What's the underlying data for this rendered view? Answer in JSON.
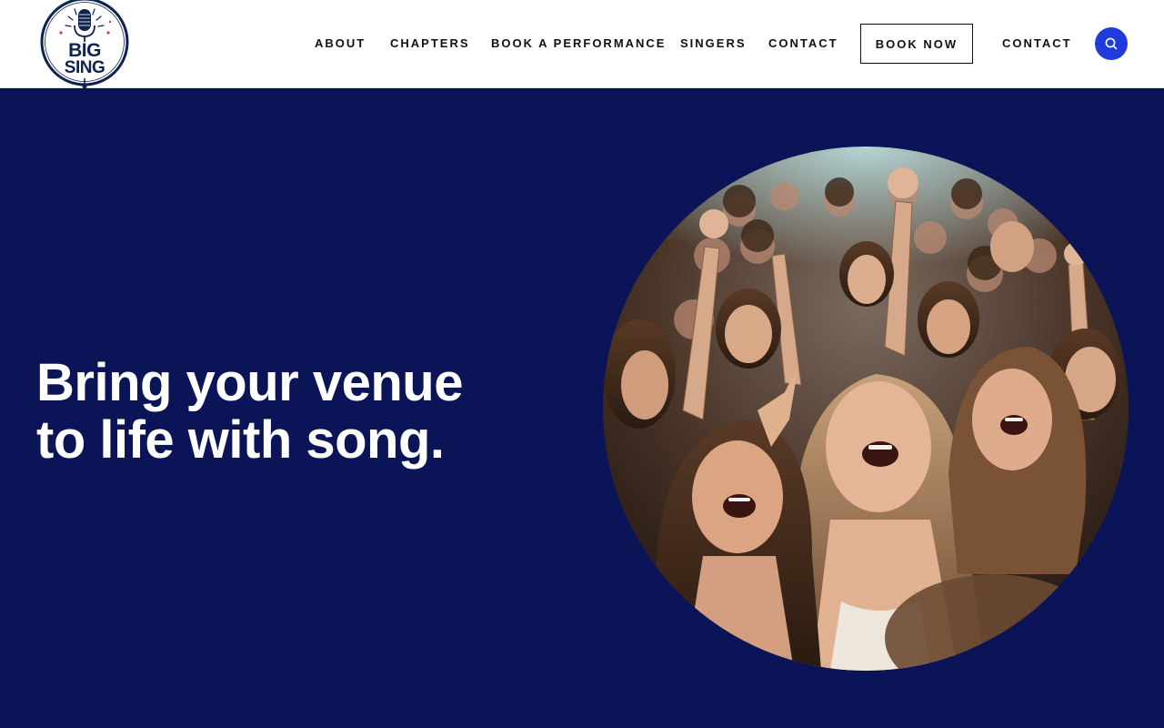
{
  "brand": {
    "logo_line1": "BIG",
    "logo_line2": "SING",
    "colors": {
      "navy": "#0b1457",
      "accent_blue": "#1f3bdc",
      "logo_pink": "#d9336a"
    }
  },
  "nav": {
    "items": [
      {
        "label": "ABOUT"
      },
      {
        "label": "CHAPTERS"
      },
      {
        "label": "BOOK A PERFORMANCE"
      },
      {
        "label": "SINGERS"
      },
      {
        "label": "CONTACT"
      }
    ],
    "book_now_label": "BOOK NOW",
    "contact_label": "CONTACT",
    "search_icon": "search-icon"
  },
  "hero": {
    "title_line1": "Bring your venue",
    "title_line2": "to life with song.",
    "image_subject": "crowd-singing-photo"
  }
}
